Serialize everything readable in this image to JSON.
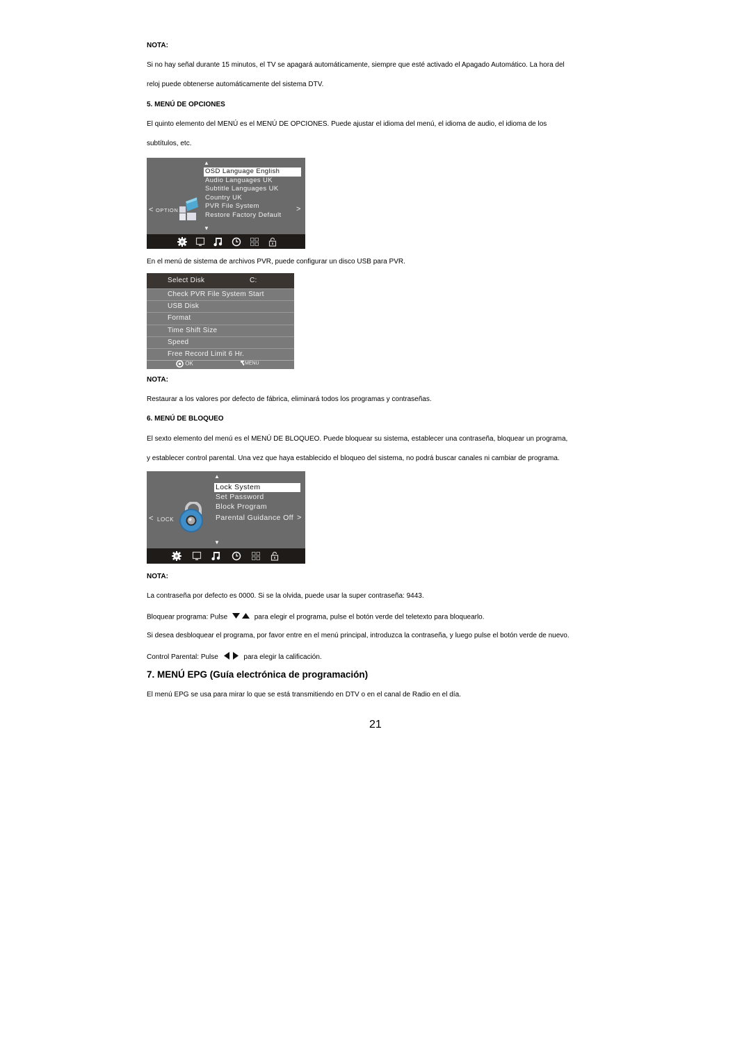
{
  "note1": {
    "heading": "NOTA:",
    "line1": "Si no hay señal durante 15 minutos, el TV se apagará automáticamente, siempre que esté activado el Apagado Automático. La hora del",
    "line2": "reloj puede obtenerse automáticamente del sistema DTV."
  },
  "section5": {
    "heading": "5. MENÚ DE OPCIONES",
    "line1": "El quinto elemento del MENÚ es el MENÚ DE OPCIONES. Puede ajustar el idioma del menú, el idioma de audio, el idioma de los",
    "line2": "subtítulos, etc.",
    "osd": {
      "side_label": "OPTION",
      "left_arrow": "<",
      "right_arrow": ">",
      "items": [
        {
          "label": "OSD Language English",
          "selected": true
        },
        {
          "label": "Audio Languages UK",
          "selected": false
        },
        {
          "label": "Subtitle Languages UK",
          "selected": false
        },
        {
          "label": "Country UK",
          "selected": false
        },
        {
          "label": "PVR File System",
          "selected": false
        },
        {
          "label": "Restore Factory Default",
          "selected": false
        }
      ],
      "bottom_icons": [
        "gear-icon",
        "tv-icon",
        "music-icon",
        "clock-icon",
        "grid-icon",
        "lock-icon"
      ]
    },
    "pvr_intro": "En el menú de sistema de archivos PVR, puede configurar un disco USB para PVR.",
    "pvr": {
      "header": {
        "label": "Select Disk",
        "value": "C:"
      },
      "rows": [
        "Check PVR File System Start",
        "USB Disk",
        "Format",
        "Time Shift Size",
        "Speed",
        "Free Record Limit 6 Hr."
      ],
      "ok_label": "OK",
      "menu_label": "MENU"
    }
  },
  "note2": {
    "heading": "NOTA:",
    "line1": "Restaurar a los valores por defecto de fábrica, eliminará todos los programas y contraseñas."
  },
  "section6": {
    "heading": "6. MENÚ DE BLOQUEO",
    "line1": "El sexto elemento del menú es el MENÚ DE BLOQUEO. Puede bloquear su sistema, establecer una contraseña, bloquear un programa,",
    "line2": "y establecer control parental. Una vez que haya establecido el bloqueo del sistema, no podrá buscar canales ni cambiar de programa.",
    "osd": {
      "side_label": "LOCK",
      "left_arrow": "<",
      "right_arrow": ">",
      "items": [
        {
          "label": "Lock System",
          "selected": true
        },
        {
          "label": "Set Password",
          "selected": false
        },
        {
          "label": "Block Program",
          "selected": false
        },
        {
          "label": "Parental Guidance Off",
          "selected": false
        }
      ],
      "bottom_icons": [
        "gear-icon",
        "tv-icon",
        "music-icon",
        "clock-icon",
        "grid-icon",
        "lock-icon"
      ]
    }
  },
  "note3": {
    "heading": "NOTA:",
    "line1": "La contraseña por defecto es 0000. Si se la olvida, puede usar la super contraseña: 9443.",
    "block_prefix": "Bloquear programa: Pulse",
    "block_suffix": "para elegir el programa, pulse el botón verde del teletexto para bloquearlo.",
    "unblock": "Si desea desbloquear el programa, por favor entre en el menú principal, introduzca la contraseña, y luego pulse el botón verde de nuevo.",
    "parental_prefix": "Control Parental: Pulse",
    "parental_suffix": "para elegir la calificación."
  },
  "section7": {
    "heading": "7. MENÚ EPG (Guía electrónica de programación)",
    "line1": "El menú EPG se usa para mirar lo que se está transmitiendo en DTV o en el canal de Radio en el día."
  },
  "page_number": "21"
}
